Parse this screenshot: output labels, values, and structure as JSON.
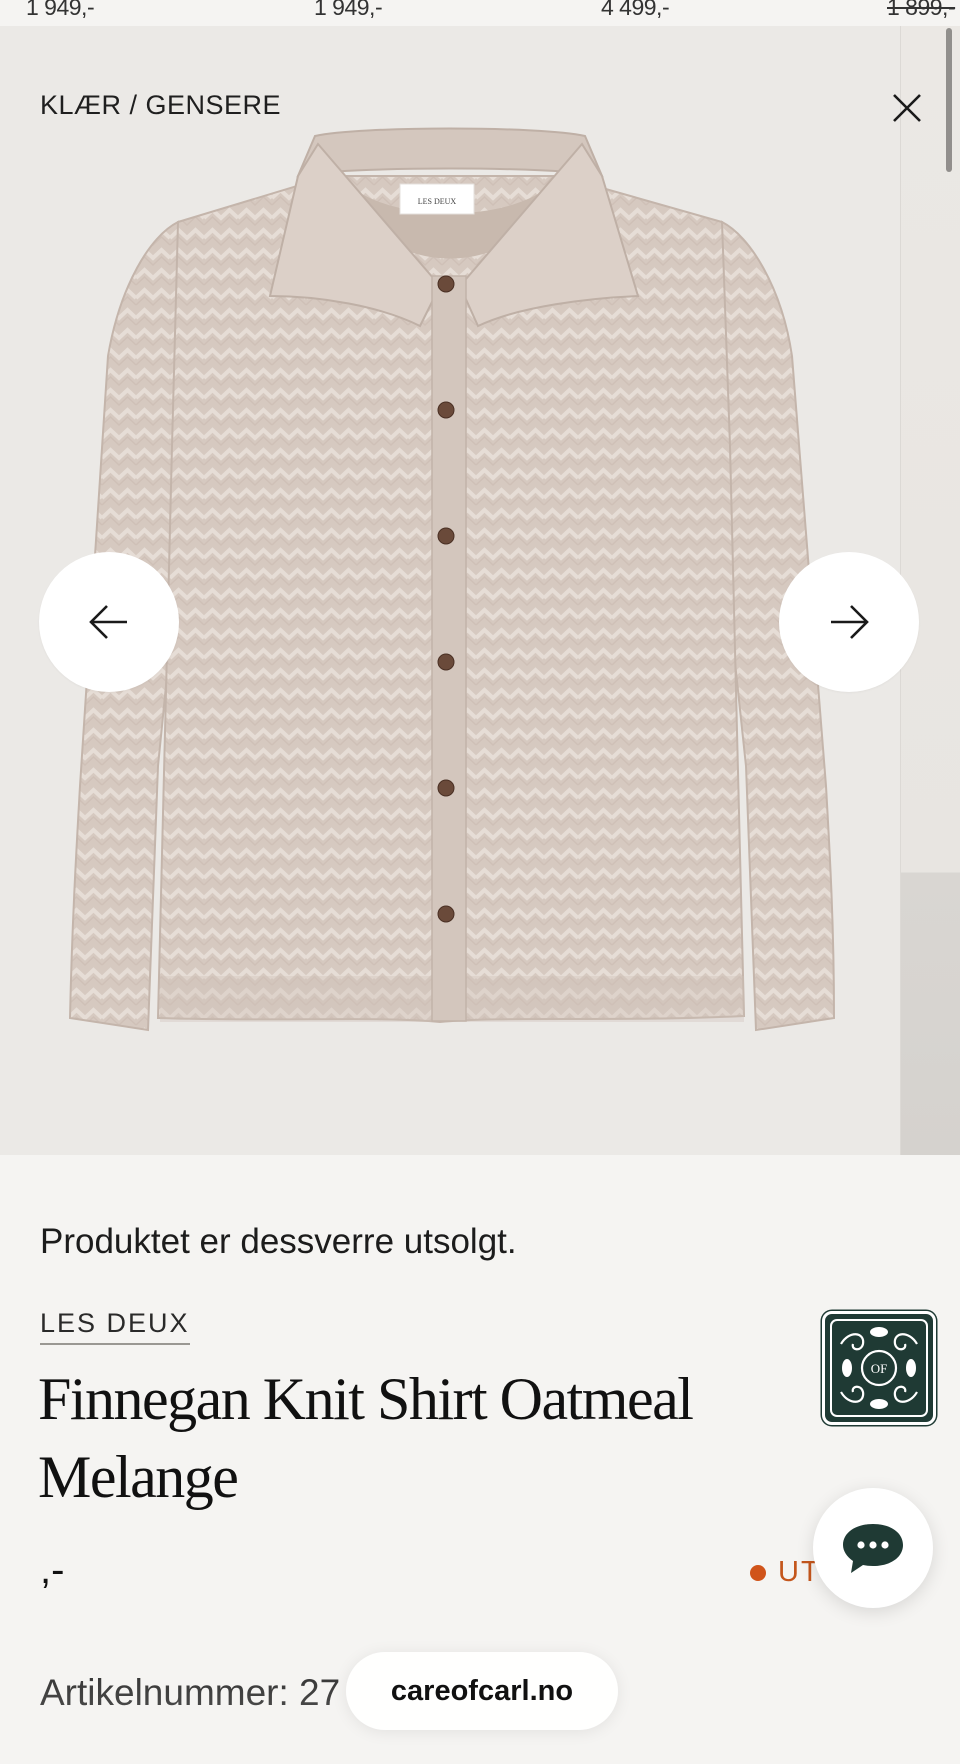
{
  "top_strip": {
    "prices": [
      "1 949,-",
      "1 949,-",
      "4 499,-",
      "1 899,-"
    ]
  },
  "gallery": {
    "breadcrumb": "KLÆR / GENSERE",
    "garment_label": "LES DEUX",
    "icons": {
      "close": "close-icon",
      "prev": "arrow-left-icon",
      "next": "arrow-right-icon"
    }
  },
  "product": {
    "soldout_message": "Produktet er dessverre utsolgt.",
    "brand": "LES DEUX",
    "title": "Finnegan Knit Shirt Oatmeal Melange",
    "price": ",-",
    "stock_status": "UTSOLGT",
    "article_number": "Artikelnummer: 27"
  },
  "widgets": {
    "store_badge_text": "OF",
    "chat_icon": "chat-bubble-icon",
    "domain": "careofcarl.no"
  },
  "colors": {
    "background": "#f5f4f2",
    "photo_background": "#ebe9e6",
    "garment": "#d7cbc2",
    "status_accent": "#d0541a",
    "badge_green": "#1f3a34"
  }
}
